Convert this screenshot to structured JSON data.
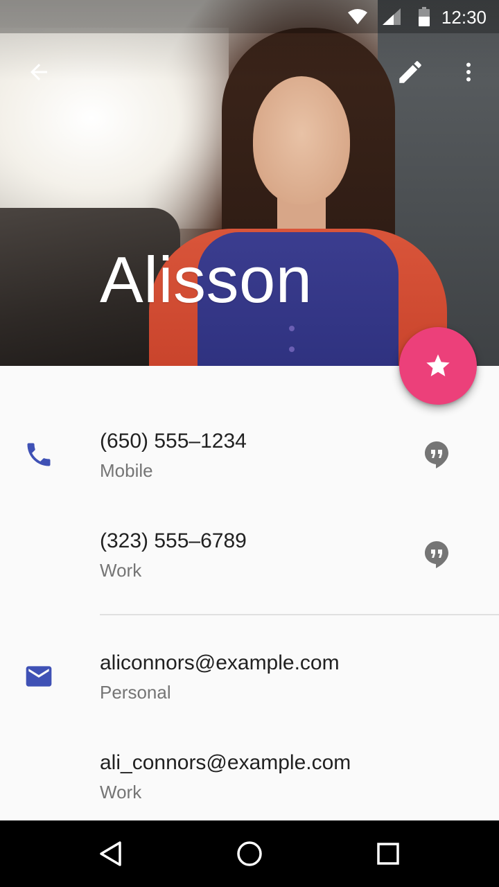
{
  "status_bar": {
    "time": "12:30"
  },
  "contact": {
    "name": "Alisson"
  },
  "phones": [
    {
      "number": "(650) 555–1234",
      "type": "Mobile"
    },
    {
      "number": "(323) 555–6789",
      "type": "Work"
    }
  ],
  "emails": [
    {
      "address": "aliconnors@example.com",
      "type": "Personal"
    },
    {
      "address": "ali_connors@example.com",
      "type": "Work"
    }
  ],
  "colors": {
    "fab": "#ec407a",
    "icon_accent": "#3f51b5",
    "hangouts_icon": "#757575"
  },
  "icons": {
    "back": "arrow-back-icon",
    "edit": "pencil-icon",
    "more": "more-vert-icon",
    "favorite": "star-icon",
    "phone": "phone-icon",
    "email": "email-icon",
    "message": "hangouts-quote-icon"
  }
}
